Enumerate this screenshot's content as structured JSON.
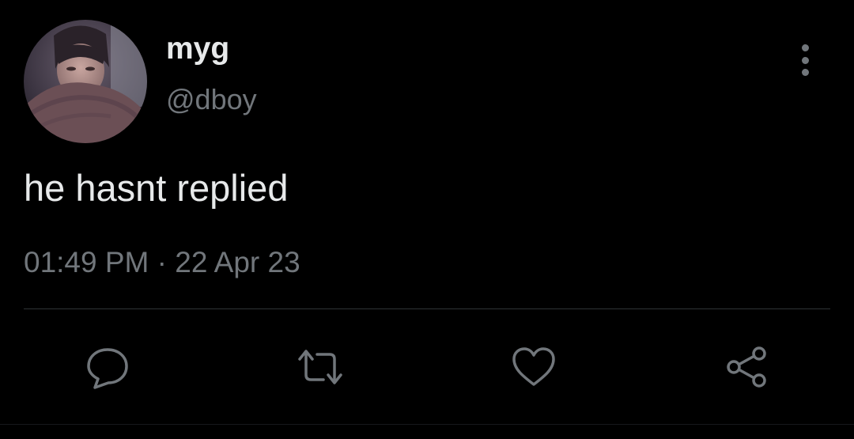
{
  "tweet": {
    "author": {
      "display_name": "myg",
      "handle": "@dboy",
      "avatar": "profile-photo"
    },
    "text": "he hasnt replied",
    "time": "01:49 PM",
    "separator": "·",
    "date": "22 Apr 23"
  },
  "actions": [
    {
      "name": "reply",
      "icon": "speech-bubble-icon"
    },
    {
      "name": "retweet",
      "icon": "retweet-icon"
    },
    {
      "name": "like",
      "icon": "heart-icon"
    },
    {
      "name": "share",
      "icon": "share-icon"
    }
  ],
  "colors": {
    "background": "#000000",
    "primary_text": "#e7e9ea",
    "secondary_text": "#71767b",
    "divider": "#2f3336",
    "icon": "#71767b"
  }
}
